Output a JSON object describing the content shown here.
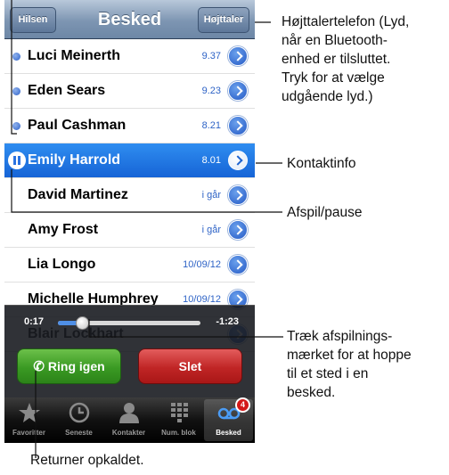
{
  "navbar": {
    "title": "Besked",
    "left_button": "Hilsen",
    "right_button": "Højttaler"
  },
  "messages": [
    {
      "name": "Luci Meinerth",
      "time": "9.37",
      "unread": true,
      "selected": false
    },
    {
      "name": "Eden Sears",
      "time": "9.23",
      "unread": true,
      "selected": false
    },
    {
      "name": "Paul Cashman",
      "time": "8.21",
      "unread": true,
      "selected": false
    },
    {
      "name": "Emily Harrold",
      "time": "8.01",
      "unread": false,
      "selected": true
    },
    {
      "name": "David Martinez",
      "time": "i går",
      "unread": false,
      "selected": false
    },
    {
      "name": "Amy Frost",
      "time": "i går",
      "unread": false,
      "selected": false
    },
    {
      "name": "Lia Longo",
      "time": "10/09/12",
      "unread": false,
      "selected": false
    },
    {
      "name": "Michelle Humphrey",
      "time": "10/09/12",
      "unread": false,
      "selected": false
    },
    {
      "name": "Blair Lockhart",
      "time": "",
      "unread": false,
      "selected": false
    }
  ],
  "playback": {
    "elapsed": "0:17",
    "remaining": "-1:23",
    "progress": 0.17
  },
  "actions": {
    "callback": "Ring igen",
    "delete": "Slet"
  },
  "tabs": [
    {
      "label": "Favoritter",
      "icon": "star-icon",
      "active": false
    },
    {
      "label": "Seneste",
      "icon": "clock-icon",
      "active": false
    },
    {
      "label": "Kontakter",
      "icon": "person-icon",
      "active": false
    },
    {
      "label": "Num. blok",
      "icon": "keypad-icon",
      "active": false
    },
    {
      "label": "Besked",
      "icon": "voicemail-icon",
      "active": true,
      "badge": "4"
    }
  ],
  "callouts": {
    "speaker": "Højttalertelefon (Lyd, når en Bluetooth-enhed er tilsluttet. Tryk for at vælge udgående lyd.)",
    "speaker_lines": [
      "Højttalertelefon (Lyd,",
      "når en Bluetooth-",
      "enhed er tilsluttet.",
      "Tryk for at vælge",
      "udgående lyd.)"
    ],
    "contact_info": "Kontaktinfo",
    "play_pause": "Afspil/pause",
    "scrubber_lines": [
      "Træk afspilnings-",
      "mærket for at hoppe",
      "til et sted i en",
      "besked."
    ],
    "return_call": "Returner opkaldet."
  }
}
